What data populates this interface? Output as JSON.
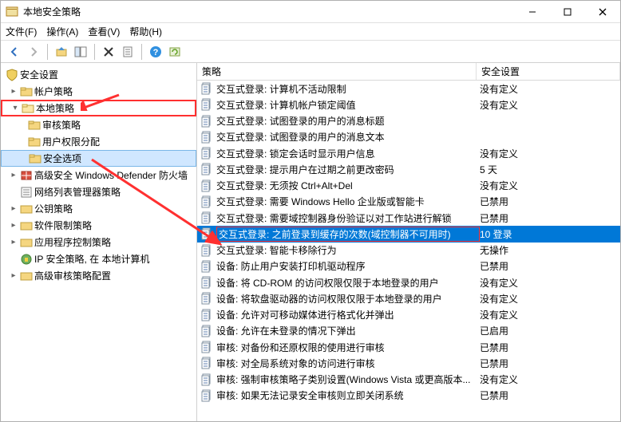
{
  "title": "本地安全策略",
  "menu": {
    "file": "文件(F)",
    "action": "操作(A)",
    "view": "查看(V)",
    "help": "帮助(H)"
  },
  "header": {
    "policy": "策略",
    "setting": "安全设置"
  },
  "tree": {
    "root": "安全设置",
    "account": "帐户策略",
    "local": "本地策略",
    "audit": "审核策略",
    "userrights": "用户权限分配",
    "secopt": "安全选项",
    "defender": "高级安全 Windows Defender 防火墙",
    "netlist": "网络列表管理器策略",
    "pubkey": "公钥策略",
    "softrest": "软件限制策略",
    "appcontrol": "应用程序控制策略",
    "ipsec": "IP 安全策略, 在  本地计算机",
    "advaudit": "高级审核策略配置"
  },
  "rows": [
    {
      "p": "交互式登录: 计算机不活动限制",
      "s": "没有定义"
    },
    {
      "p": "交互式登录: 计算机帐户锁定阈值",
      "s": "没有定义"
    },
    {
      "p": "交互式登录: 试图登录的用户的消息标题",
      "s": ""
    },
    {
      "p": "交互式登录: 试图登录的用户的消息文本",
      "s": ""
    },
    {
      "p": "交互式登录: 锁定会话时显示用户信息",
      "s": "没有定义"
    },
    {
      "p": "交互式登录: 提示用户在过期之前更改密码",
      "s": "5 天"
    },
    {
      "p": "交互式登录: 无须按 Ctrl+Alt+Del",
      "s": "没有定义"
    },
    {
      "p": "交互式登录: 需要 Windows Hello 企业版或智能卡",
      "s": "已禁用"
    },
    {
      "p": "交互式登录: 需要域控制器身份验证以对工作站进行解锁",
      "s": "已禁用"
    },
    {
      "p": "交互式登录: 之前登录到缓存的次数(域控制器不可用时)",
      "s": "10 登录",
      "sel": true
    },
    {
      "p": "交互式登录: 智能卡移除行为",
      "s": "无操作"
    },
    {
      "p": "设备: 防止用户安装打印机驱动程序",
      "s": "已禁用"
    },
    {
      "p": "设备: 将 CD-ROM 的访问权限仅限于本地登录的用户",
      "s": "没有定义"
    },
    {
      "p": "设备: 将软盘驱动器的访问权限仅限于本地登录的用户",
      "s": "没有定义"
    },
    {
      "p": "设备: 允许对可移动媒体进行格式化并弹出",
      "s": "没有定义"
    },
    {
      "p": "设备: 允许在未登录的情况下弹出",
      "s": "已启用"
    },
    {
      "p": "审核: 对备份和还原权限的使用进行审核",
      "s": "已禁用"
    },
    {
      "p": "审核: 对全局系统对象的访问进行审核",
      "s": "已禁用"
    },
    {
      "p": "审核: 强制审核策略子类别设置(Windows Vista 或更高版本...",
      "s": "没有定义"
    },
    {
      "p": "审核: 如果无法记录安全审核则立即关闭系统",
      "s": "已禁用"
    }
  ]
}
